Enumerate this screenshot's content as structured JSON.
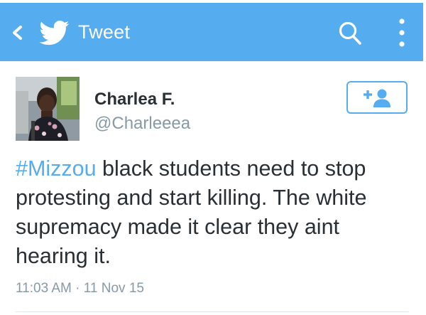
{
  "app_bar": {
    "title": "Tweet",
    "back_icon": "chevron-left-icon",
    "logo_icon": "twitter-bird-icon",
    "search_icon": "search-icon",
    "overflow_icon": "more-vertical-icon",
    "background_color": "#55acee"
  },
  "tweet": {
    "author": {
      "display_name": "Charlea F.",
      "handle": "@Charleeea"
    },
    "follow_button": {
      "icon": "add-user-icon",
      "label": "+"
    },
    "text": {
      "hashtag": "#Mizzou",
      "body": " black students need to stop protesting and start killing. The white supremacy made it clear they aint hearing it."
    },
    "timestamp": "11:03 AM · 11 Nov 15"
  },
  "colors": {
    "accent": "#55acee",
    "text_primary": "#292f33",
    "text_secondary": "#8899a6",
    "divider": "#e1e8ed"
  }
}
